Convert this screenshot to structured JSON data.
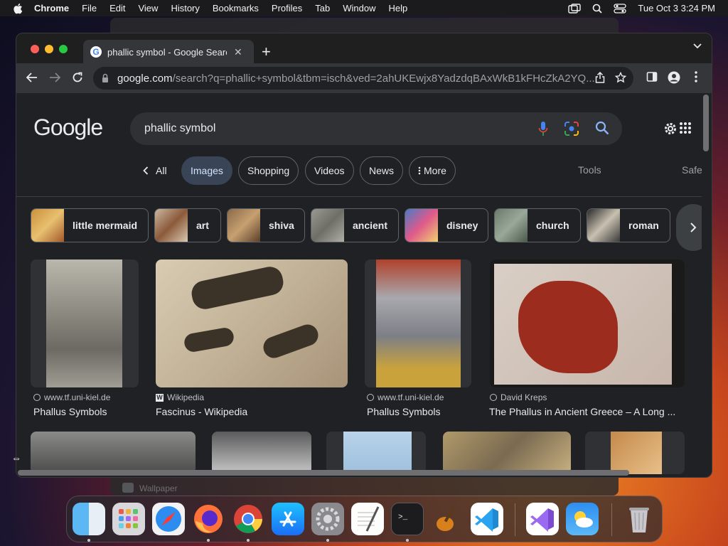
{
  "menubar": {
    "app": "Chrome",
    "items": [
      "File",
      "Edit",
      "View",
      "History",
      "Bookmarks",
      "Profiles",
      "Tab",
      "Window",
      "Help"
    ],
    "datetime": "Tue Oct 3  3:24 PM"
  },
  "background_window": {
    "label": "Wallpaper"
  },
  "tab": {
    "title": "phallic symbol - Google Search"
  },
  "omnibox": {
    "host": "google.com",
    "path": "/search?q=phallic+symbol&tbm=isch&ved=2ahUKEwjx8YadzdqBAxWkB1kFHcZkA2YQ..."
  },
  "page": {
    "logo": "Google",
    "query": "phallic symbol",
    "filters": {
      "all": "All",
      "images": "Images",
      "shopping": "Shopping",
      "videos": "Videos",
      "news": "News",
      "more": "More",
      "tools": "Tools",
      "safe": "Safe"
    },
    "related": [
      "little mermaid",
      "art",
      "shiva",
      "ancient",
      "disney",
      "church",
      "roman"
    ],
    "results": [
      {
        "source": "www.tf.uni-kiel.de",
        "caption": "Phallus Symbols"
      },
      {
        "source": "Wikipedia",
        "caption": "Fascinus - Wikipedia"
      },
      {
        "source": "www.tf.uni-kiel.de",
        "caption": "Phallus Symbols"
      },
      {
        "source": "David Kreps",
        "caption": "The Phallus in Ancient Greece – A Long ..."
      }
    ]
  },
  "colors": {
    "accent": "#8ab4f8",
    "chip_active": "#394457",
    "page_bg": "#202124"
  },
  "dock": [
    "finder-icon",
    "launchpad-icon",
    "safari-icon",
    "firefox-icon",
    "chrome-icon",
    "app-store-icon",
    "system-settings-icon",
    "textedit-icon",
    "terminal-icon",
    "garageband-icon",
    "vscode-icon",
    "visual-studio-icon",
    "weather-icon",
    "trash-icon"
  ]
}
